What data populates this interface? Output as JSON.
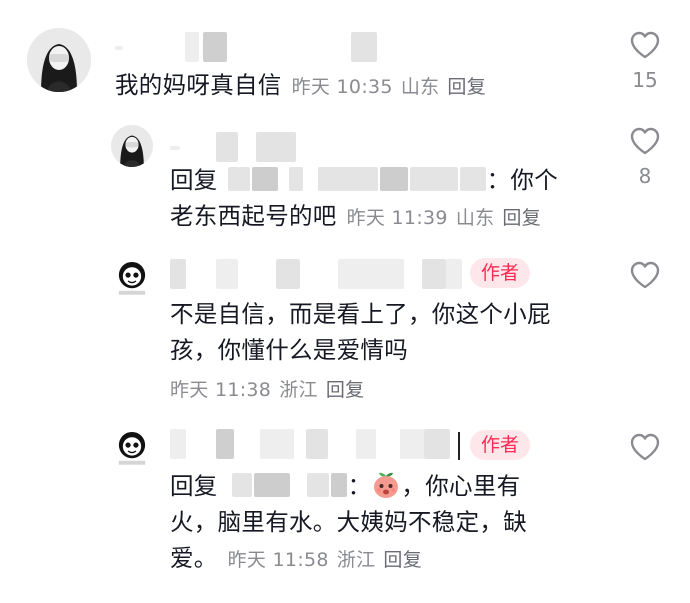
{
  "comments": [
    {
      "text": "我的妈呀真自信",
      "time": "昨天 10:35",
      "location": "山东",
      "reply": "回复",
      "likes": "15"
    },
    {
      "reply_prefix": "回复",
      "text_line1_suffix": "：你个",
      "text_line2": "老东西起号的吧",
      "time": "昨天 11:39",
      "location": "山东",
      "reply": "回复",
      "likes": "8"
    },
    {
      "author_tag": "作者",
      "text_line1": "不是自信，而是看上了，你这个小屁",
      "text_line2": "孩，你懂什么是爱情吗",
      "time": "昨天 11:38",
      "location": "浙江",
      "reply": "回复"
    },
    {
      "author_tag": "作者",
      "reply_prefix": "回复",
      "text_line1_suffix": "，你心里有",
      "text_line2": "火，脑里有水。大姨妈不稳定，缺",
      "text_line3": "爱。",
      "time": "昨天 11:58",
      "location": "浙江",
      "reply": "回复"
    }
  ],
  "icons": {
    "like": "heart-outline-icon",
    "emoji": "peach-emoji-icon"
  },
  "colors": {
    "text": "#161823",
    "meta": "#8a8b91",
    "author_tag_bg": "#fde7ea",
    "author_tag_text": "#fe2c55"
  }
}
